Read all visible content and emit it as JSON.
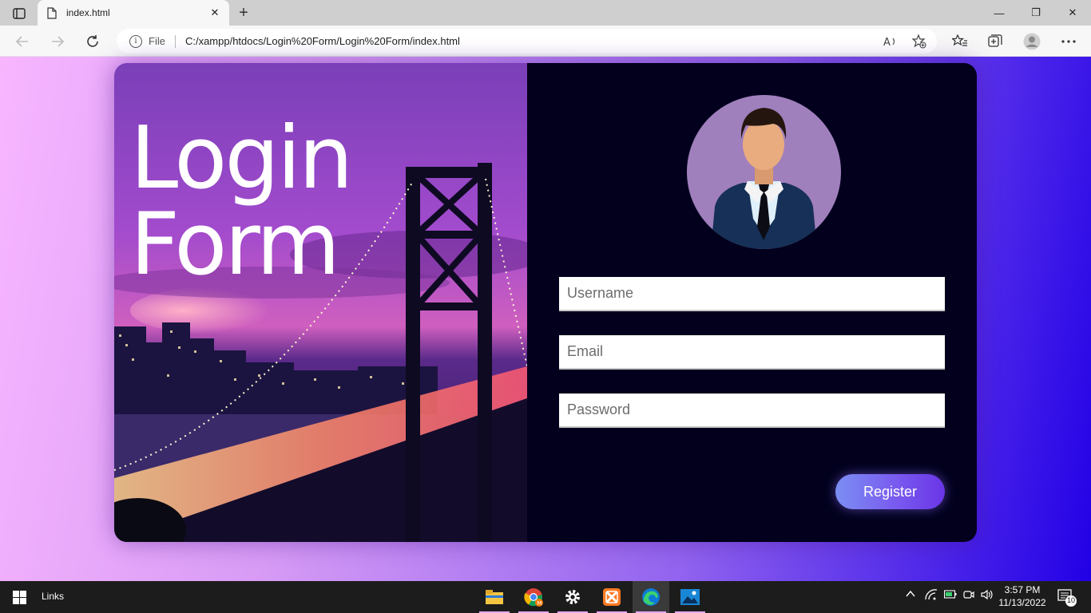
{
  "browser": {
    "tab_title": "index.html",
    "tab_close": "✕",
    "new_tab": "+",
    "window_controls": {
      "minimize": "—",
      "restore": "❐",
      "close": "✕"
    },
    "address": {
      "scheme_label": "File",
      "url": "C:/xampp/htdocs/Login%20Form/Login%20Form/index.html"
    }
  },
  "hero": {
    "title_line1": "Login",
    "title_line2": "Form"
  },
  "form": {
    "username_placeholder": "Username",
    "email_placeholder": "Email",
    "password_placeholder": "Password",
    "register_label": "Register"
  },
  "taskbar": {
    "links_label": "Links",
    "time": "3:57 PM",
    "date": "11/13/2022",
    "notification_count": "10"
  },
  "colors": {
    "card_right_bg": "#02001d",
    "register_gradient": [
      "#7b8ff2",
      "#6a35e6"
    ],
    "page_gradient": [
      "#f8b6ff",
      "#2200e6"
    ]
  }
}
